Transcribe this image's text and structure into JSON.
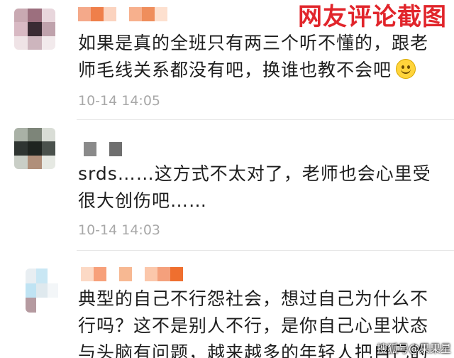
{
  "banner": {
    "title": "网友评论截图"
  },
  "comments": [
    {
      "text": "如果是真的全班只有两三个听不懂的，跟老师毛线关系都没有吧，换谁也教不会吧",
      "emoji": "smile-emoji",
      "time": "10-14 14:05",
      "avatar_colors": [
        "#c9a9b2",
        "#9c6f7e",
        "#e8d6dc",
        "#d8b9c3",
        "#3a2b33",
        "#bfa2ac",
        "#efe3e6",
        "#cdb5bd",
        "#f2eaec"
      ],
      "username_colors": [
        "#f4a98a",
        "#ef7f4a",
        "#fbd3bf",
        "#ffffff",
        "#f7b08d",
        "#ef8e5c",
        "#fde0cf"
      ]
    },
    {
      "text": "srds……这方式不太对了，老师也会心里受很大创伤吧……",
      "time": "10-14 14:03",
      "avatar_colors": [
        "#a9b1a6",
        "#7d8579",
        "#d9ddd6",
        "#2f3532",
        "#1f2420",
        "#4a514c",
        "#c9cec6",
        "#b08f7a",
        "#e6e9e3"
      ],
      "username_colors": [
        "#8a8a8a",
        "#ffffff",
        "#6f6f6f"
      ]
    },
    {
      "text": "典型的自己不行怨社会，想过自己为什么不行吗？这不是别人不行，是你自己心里状态与头脑有问题，越来越多的年轻人把自己的",
      "time": "",
      "avatar_colors": [
        "#e8eef2",
        "#c9e7f4",
        "#ffffff",
        "#bfe3f3",
        "#dfe9ee",
        "#f3f6f8",
        "#b59aa0",
        "#ffffff",
        "#ffffff"
      ],
      "username_colors": [
        "#fcd9c5",
        "#f7a07a",
        "#ffffff",
        "#f7b892",
        "#ffffff",
        "#fbc7ab",
        "#f4a07c",
        "#ef6f2f"
      ]
    }
  ],
  "watermark": {
    "text": "搜狐号@果果星"
  }
}
